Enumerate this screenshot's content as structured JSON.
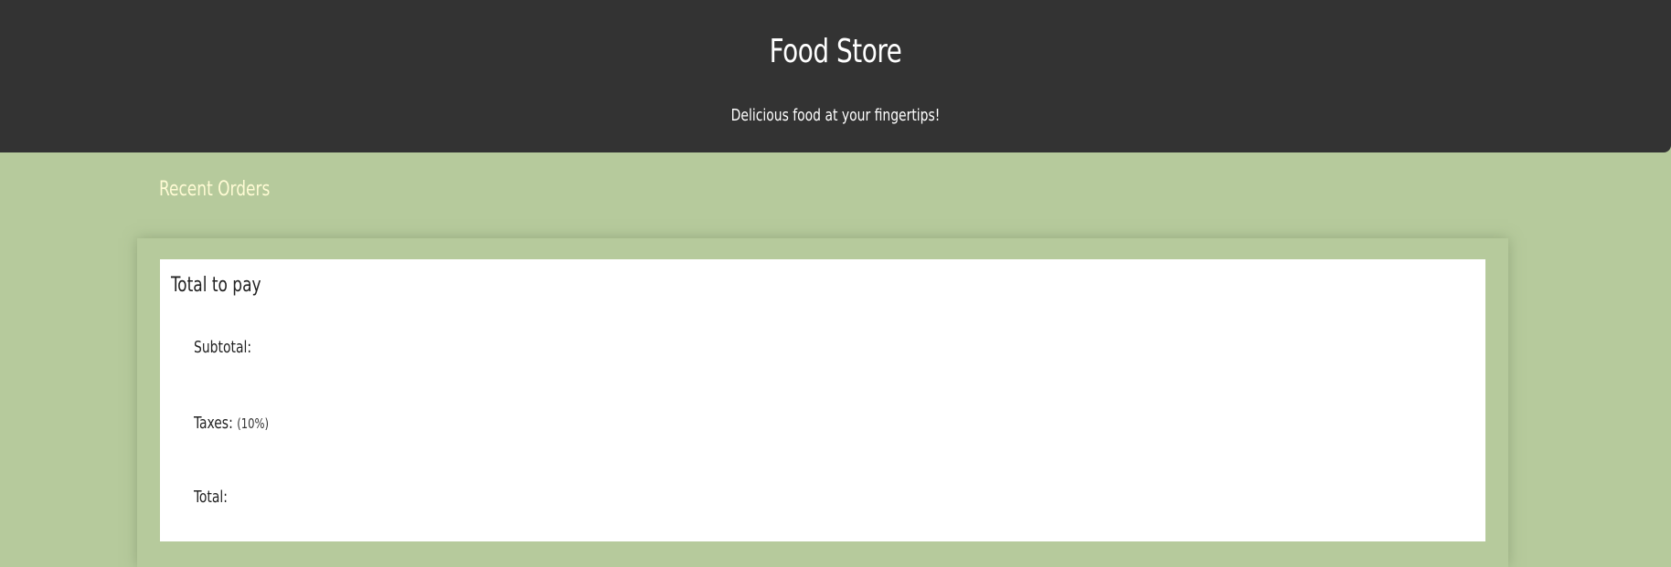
{
  "header": {
    "title": "Food Store",
    "tagline": "Delicious food at your fingertips!"
  },
  "main": {
    "section_title": "Recent Orders",
    "summary": {
      "title": "Total to pay",
      "subtotal_label": "Subtotal:",
      "taxes_label": "Taxes:",
      "taxes_note": "(10%)",
      "total_label": "Total:"
    }
  },
  "colors": {
    "header_bg": "#333333",
    "page_bg": "#b6ca9c",
    "section_title": "#fffbd4",
    "card_bg": "#ffffff"
  }
}
